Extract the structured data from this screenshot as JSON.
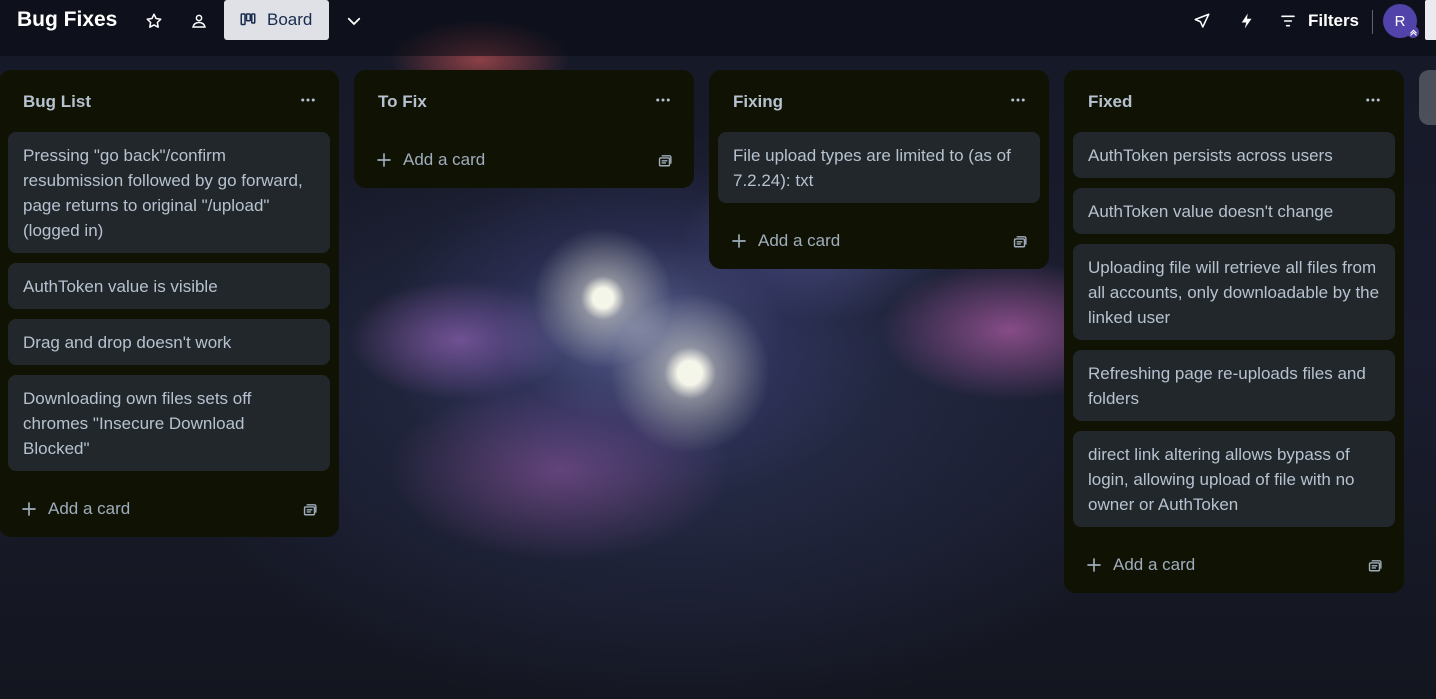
{
  "header": {
    "board_title": "Bug Fixes",
    "view_label": "Board",
    "filters_label": "Filters",
    "avatar_initial": "R"
  },
  "lists": [
    {
      "title": "Bug List",
      "cards": [
        "Pressing \"go back\"/confirm resubmission followed by go forward, page returns to original \"/upload\" (logged in)",
        "AuthToken value is visible",
        "Drag and drop doesn't work",
        "Downloading own files sets off chromes \"Insecure Download Blocked\""
      ],
      "add_label": "Add a card"
    },
    {
      "title": "To Fix",
      "cards": [],
      "add_label": "Add a card"
    },
    {
      "title": "Fixing",
      "cards": [
        "File upload types are limited to (as of 7.2.24): txt"
      ],
      "add_label": "Add a card"
    },
    {
      "title": "Fixed",
      "cards": [
        "AuthToken persists across users",
        "AuthToken value doesn't change",
        "Uploading file will retrieve all files from all accounts, only downloadable by the linked user",
        "Refreshing page re-uploads files and folders",
        "direct link altering allows bypass of login, allowing upload of file with no owner or AuthToken"
      ],
      "add_label": "Add a card"
    }
  ],
  "colors": {
    "list_bg": "#101204",
    "card_bg": "#22272b",
    "text": "#b6c2cf",
    "avatar": "#5243aa"
  }
}
